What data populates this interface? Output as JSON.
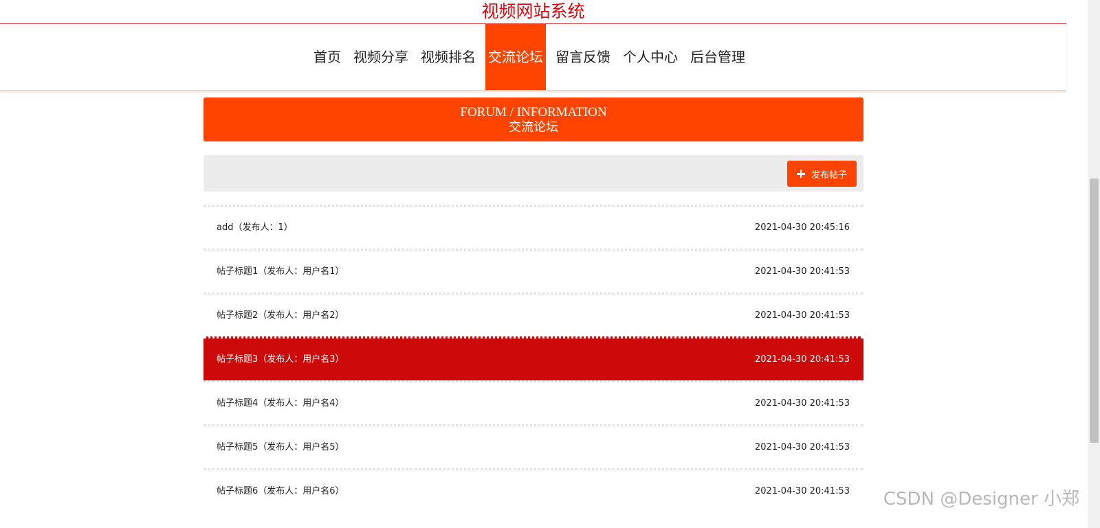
{
  "site": {
    "title": "视频网站系统"
  },
  "nav": {
    "items": [
      {
        "label": "首页"
      },
      {
        "label": "视频分享"
      },
      {
        "label": "视频排名"
      },
      {
        "label": "交流论坛",
        "active": true
      },
      {
        "label": "留言反馈"
      },
      {
        "label": "个人中心"
      },
      {
        "label": "后台管理"
      }
    ]
  },
  "banner": {
    "en": "FORUM / INFORMATION",
    "cn": "交流论坛"
  },
  "toolbar": {
    "add_label": "发布帖子",
    "add_icon": "plus-icon"
  },
  "posts": [
    {
      "title": "add（发布人：1）",
      "time": "2021-04-30 20:45:16"
    },
    {
      "title": "帖子标题1（发布人：用户名1）",
      "time": "2021-04-30 20:41:53"
    },
    {
      "title": "帖子标题2（发布人：用户名2）",
      "time": "2021-04-30 20:41:53"
    },
    {
      "title": "帖子标题3（发布人：用户名3）",
      "time": "2021-04-30 20:41:53",
      "highlighted": true
    },
    {
      "title": "帖子标题4（发布人：用户名4）",
      "time": "2021-04-30 20:41:53"
    },
    {
      "title": "帖子标题5（发布人：用户名5）",
      "time": "2021-04-30 20:41:53"
    },
    {
      "title": "帖子标题6（发布人：用户名6）",
      "time": "2021-04-30 20:41:53"
    }
  ],
  "watermark": "CSDN @Designer 小郑",
  "colors": {
    "accent": "#ff4400",
    "title_red": "#e3060f",
    "highlight_row": "#cc0a0a"
  }
}
